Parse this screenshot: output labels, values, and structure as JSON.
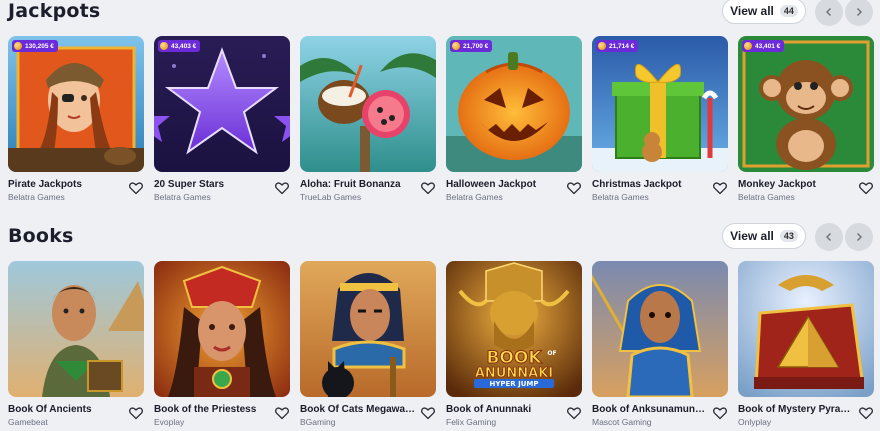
{
  "sections": [
    {
      "title": "Jackpots",
      "view_all_label": "View all",
      "count": "44",
      "games": [
        {
          "name": "Pirate Jackpots",
          "provider": "Belatra Games",
          "jackpot": "130,205 €",
          "art": "pirate"
        },
        {
          "name": "20 Super Stars",
          "provider": "Belatra Games",
          "jackpot": "43,403 €",
          "art": "stars"
        },
        {
          "name": "Aloha: Fruit Bonanza",
          "provider": "TrueLab Games",
          "jackpot": "",
          "art": "aloha"
        },
        {
          "name": "Halloween Jackpot",
          "provider": "Belatra Games",
          "jackpot": "21,700 €",
          "art": "pumpkin"
        },
        {
          "name": "Christmas Jackpot",
          "provider": "Belatra Games",
          "jackpot": "21,714 €",
          "art": "gift"
        },
        {
          "name": "Monkey Jackpot",
          "provider": "Belatra Games",
          "jackpot": "43,401 €",
          "art": "monkey"
        }
      ]
    },
    {
      "title": "Books",
      "view_all_label": "View all",
      "count": "43",
      "games": [
        {
          "name": "Book Of Ancients",
          "provider": "Gamebeat",
          "jackpot": "",
          "art": "ancients"
        },
        {
          "name": "Book of the Priestess",
          "provider": "Evoplay",
          "jackpot": "",
          "art": "priestess"
        },
        {
          "name": "Book Of Cats Megaways",
          "provider": "BGaming",
          "jackpot": "",
          "art": "cats"
        },
        {
          "name": "Book of Anunnaki",
          "provider": "Felix Gaming",
          "jackpot": "",
          "art": "anunnaki",
          "art_text": [
            "BOOK",
            "OF",
            "ANUNNAKI",
            "HYPER JUMP"
          ]
        },
        {
          "name": "Book of Anksunamun: Rock...",
          "provider": "Mascot Gaming",
          "jackpot": "",
          "art": "anksunamun"
        },
        {
          "name": "Book of Mystery Pyramids",
          "provider": "Onlyplay",
          "jackpot": "",
          "art": "pyramids"
        }
      ]
    }
  ],
  "icons": {
    "favorite": "heart-outline-icon",
    "prev": "chevron-left-icon",
    "next": "chevron-right-icon",
    "jackpot_coin": "coin-icon"
  },
  "colors": {
    "background": "#eef0f3",
    "badge": "#6c2bd9",
    "nav_button": "#d7dadf"
  }
}
